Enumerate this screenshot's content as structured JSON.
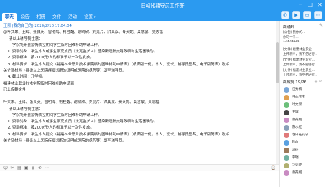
{
  "window": {
    "title": "自动化辅导员工作群"
  },
  "tabs": [
    {
      "label": "聊天",
      "active": true
    },
    {
      "label": "公告",
      "active": false
    },
    {
      "label": "相册",
      "active": false
    },
    {
      "label": "文件",
      "active": false
    },
    {
      "label": "活动",
      "active": false
    },
    {
      "label": "设置",
      "active": false
    }
  ],
  "window_controls": [
    "─",
    "☐",
    "✕"
  ],
  "messages": [
    {
      "text": "王刚 (我的自己的)  2020/2/10  17:04:04",
      "style": "sender"
    },
    {
      "text": "@叶文果、王辉、张良英、曾明海、柯桂馥、谢晓欣、刘亮芹、洪其双、秦英妮、莫慧敏、吴志福",
      "style": ""
    },
    {
      "text": "请以上辅导员注意：",
      "style": "indent1"
    },
    {
      "text": "学院将开展疫情防控期间学生临时困难补助申请工作。",
      "style": "indent2"
    },
    {
      "text": "1.    资助对象：学生本人或学生家庭成员（法定监护人）感染新冠肺炎导致临时生活困难的。",
      "style": "indent3"
    },
    {
      "text": "2.    资助标准：按2000元/人的标准予以一次性发放。",
      "style": "indent3"
    },
    {
      "text": "3.    材料要求：学生本人提交《福建林业职业技术学院临时困难补助申请表》（纸质版一份，本人、班长、辅导员签名；电子版简表）及相",
      "style": "indent3"
    },
    {
      "text": "关佐证材料（县级以上医院疾病诊断的证明或医院的病历等）发至辅导员。",
      "style": ""
    },
    {
      "text": "4.    截止时间：开学初。",
      "style": "indent3"
    },
    {
      "text": "福建林业职业技术学院临时困难补助申请表",
      "style": ""
    },
    {
      "text": "已上传群文件",
      "style": ""
    },
    {
      "text": "",
      "style": "gap"
    },
    {
      "text": "叶文果、王辉、张良英、曾明海、柯桂馥、谢晓欣、刘亮芹、洪其双、秦英妮、莫慧敏、吴志福",
      "style": ""
    },
    {
      "text": "请以上辅导员注意：",
      "style": "indent1"
    },
    {
      "text": "学院将开展疫情防控期间学生临时困难补助申请工作。",
      "style": "indent2"
    },
    {
      "text": "1.    资助对象：学生本人或学生家庭成员（法定监护人）感染新冠肺炎导致临时生活困难的。",
      "style": "indent3"
    },
    {
      "text": "2.    资助标准：按2000元/人的标准予以一次性发放。",
      "style": "indent3"
    },
    {
      "text": "3.    材料要求：学生本人提交《福建林业职业技术学院临时困难补助申请表》（纸质版一份，本人、班长、辅导员签名；电子版简表）及相",
      "style": "indent3"
    },
    {
      "text": "关佐证材料（县级以上医院疾病诊断的证明或医院的病历等）发至辅导员。",
      "style": ""
    }
  ],
  "toolbar_icons": [
    "emoji-icon",
    "scissors-icon",
    "folder-icon",
    "image-icon",
    "gift-icon",
    "phone-icon",
    "more-icon"
  ],
  "sidebar": {
    "notice_title": "群通知",
    "notice_lines": [
      "[公告] 我你的...",
      "你可一个...",
      "13474134",
      "[文件] 福建林业职业...",
      "上传新人，我不把进行...",
      "[文件] 福建林业职业...",
      "上传新人，我不把进行...",
      "[文件] 福建林业职业...",
      "上传新人，我不把进行..."
    ],
    "members_title": "群成员 19/26",
    "members": [
      {
        "name": "汪秀梅",
        "color": "#7aa6d6"
      },
      {
        "name": "开心宝宝",
        "color": "#e0a050"
      },
      {
        "name": "叶文果",
        "color": "#6cbf7a"
      },
      {
        "name": "王辉",
        "color": "#444444"
      },
      {
        "name": "秦英妮",
        "color": "#c98bc2"
      },
      {
        "name": "陈水红",
        "color": "#8aa0b8"
      },
      {
        "name": "春日在花枝",
        "color": "#e07a7a"
      },
      {
        "name": "Fish",
        "color": "#5aa0e0"
      },
      {
        "name": "冯征",
        "color": "#9c7a5a"
      },
      {
        "name": "李瑞",
        "color": "#70b0a0"
      },
      {
        "name": "刘亮芹",
        "color": "#b0b070"
      },
      {
        "name": "秦英妮",
        "color": "#c98bc2"
      }
    ]
  }
}
